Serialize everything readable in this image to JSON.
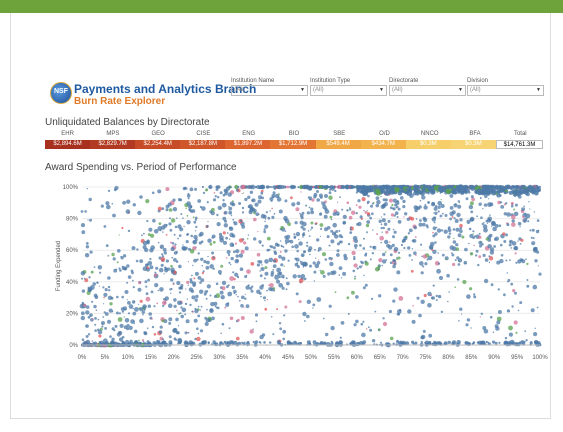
{
  "header": {
    "title": "Payments and Analytics Branch",
    "subtitle": "Burn Rate Explorer",
    "logo_text": "NSF"
  },
  "filters": [
    {
      "label": "Institution Name",
      "value": "(All)"
    },
    {
      "label": "Institution Type",
      "value": "(All)"
    },
    {
      "label": "Directorate",
      "value": "(All)"
    },
    {
      "label": "Division",
      "value": "(All)"
    }
  ],
  "balances": {
    "title": "Unliquidated Balances by Directorate",
    "directorates": [
      {
        "name": "EHR",
        "value": "$2,894.6M",
        "color": "#a7301f"
      },
      {
        "name": "MPS",
        "value": "$2,829.7M",
        "color": "#b23a22"
      },
      {
        "name": "GEO",
        "value": "$2,254.4M",
        "color": "#c64b26"
      },
      {
        "name": "CISE",
        "value": "$2,187.8M",
        "color": "#cf562a"
      },
      {
        "name": "ENG",
        "value": "$1,897.2M",
        "color": "#dc6530"
      },
      {
        "name": "BIO",
        "value": "$1,712.9M",
        "color": "#e47635"
      },
      {
        "name": "SBE",
        "value": "$549.4M",
        "color": "#f0a846"
      },
      {
        "name": "O/D",
        "value": "$434.7M",
        "color": "#f2b24c"
      },
      {
        "name": "NNCO",
        "value": "$0.3M",
        "color": "#f6cf6b"
      },
      {
        "name": "BFA",
        "value": "$0.3M",
        "color": "#f7d473"
      },
      {
        "name": "Total",
        "value": "$14,761.3M",
        "color": "#ffffff"
      }
    ]
  },
  "chart": {
    "title": "Award Spending vs. Period of Performance",
    "ylabel": "Funding Expended"
  },
  "chart_data": {
    "type": "scatter",
    "title": "Award Spending vs. Period of Performance",
    "xlabel": "",
    "ylabel": "Funding Expended",
    "x_ticks": [
      "0%",
      "5%",
      "10%",
      "15%",
      "20%",
      "25%",
      "30%",
      "35%",
      "40%",
      "45%",
      "50%",
      "55%",
      "60%",
      "65%",
      "70%",
      "75%",
      "80%",
      "85%",
      "90%",
      "95%",
      "100%"
    ],
    "y_ticks": [
      "0%",
      "20%",
      "40%",
      "60%",
      "80%",
      "100%"
    ],
    "xlim": [
      0,
      100
    ],
    "ylim": [
      0,
      100
    ],
    "colors": {
      "main": "#4e79a7",
      "green": "#59a14f",
      "pink": "#d37295",
      "red": "#e15759"
    },
    "series": [
      {
        "values": [
          [
            6,
            2
          ],
          [
            12,
            18
          ],
          [
            18,
            40
          ],
          [
            24,
            55
          ],
          [
            30,
            66
          ],
          [
            35,
            75
          ],
          [
            42,
            82
          ],
          [
            48,
            86
          ],
          [
            54,
            90
          ],
          [
            60,
            93
          ],
          [
            66,
            95
          ],
          [
            72,
            96
          ],
          [
            78,
            97
          ],
          [
            84,
            98
          ],
          [
            90,
            99
          ],
          [
            96,
            99
          ]
        ]
      }
    ]
  }
}
